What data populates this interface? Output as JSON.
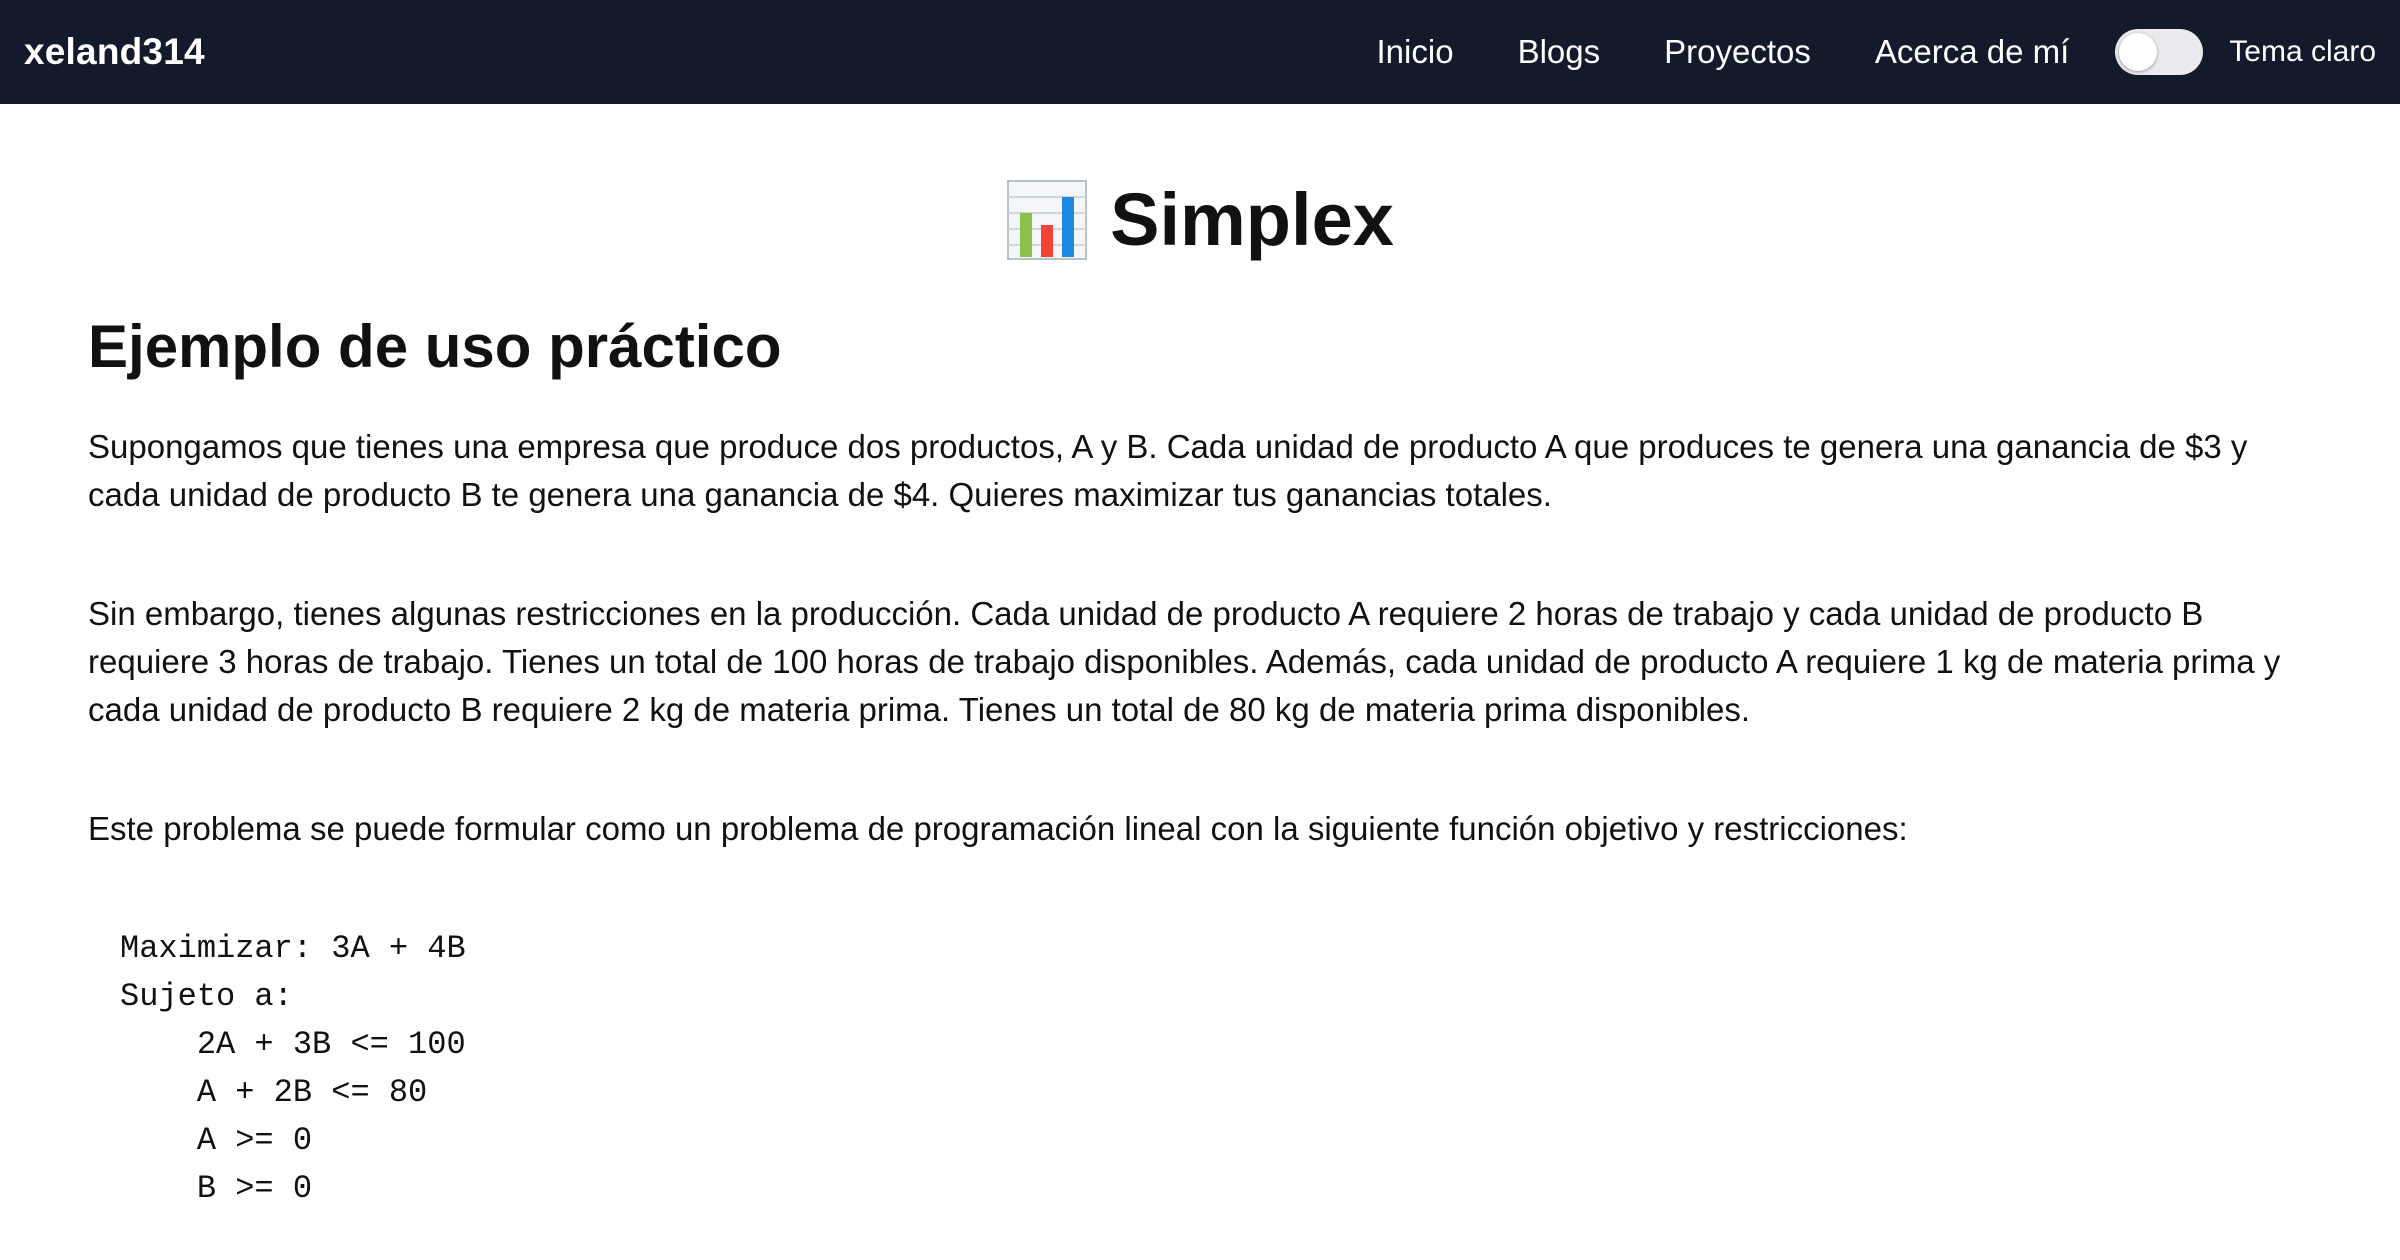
{
  "navbar": {
    "brand": "xeland314",
    "links": [
      "Inicio",
      "Blogs",
      "Proyectos",
      "Acerca de mí"
    ],
    "theme_label": "Tema claro"
  },
  "page": {
    "title": "Simplex",
    "title_icon": "bar-chart-icon",
    "section_heading": "Ejemplo de uso práctico",
    "paragraphs": [
      "Supongamos que tienes una empresa que produce dos productos, A y B. Cada unidad de producto A que produces te genera una ganancia de $3 y cada unidad de producto B te genera una ganancia de $4. Quieres maximizar tus ganancias totales.",
      "Sin embargo, tienes algunas restricciones en la producción. Cada unidad de producto A requiere 2 horas de trabajo y cada unidad de producto B requiere 3 horas de trabajo. Tienes un total de 100 horas de trabajo disponibles. Además, cada unidad de producto A requiere 1 kg de materia prima y cada unidad de producto B requiere 2 kg de materia prima. Tienes un total de 80 kg de materia prima disponibles.",
      "Este problema se puede formular como un problema de programación lineal con la siguiente función objetivo y restricciones:"
    ],
    "code": "Maximizar: 3A + 4B\nSujeto a:\n    2A + 3B <= 100\n    A + 2B <= 80\n    A >= 0\n    B >= 0"
  },
  "colors": {
    "navbar_bg": "#131a2b",
    "text": "#111111",
    "background": "#ffffff"
  }
}
